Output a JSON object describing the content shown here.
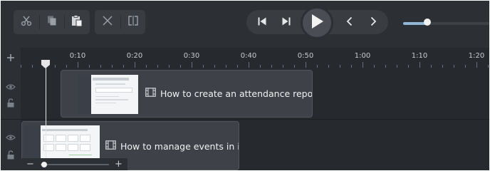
{
  "toolbar": {
    "edit_icons": [
      "scissors-icon",
      "copy-icon",
      "paste-icon"
    ],
    "split_icons": [
      "cut-gap-icon",
      "split-icon"
    ],
    "transport_icons": [
      "skip-to-start-icon",
      "step-forward-icon",
      "play-icon",
      "previous-icon",
      "next-icon"
    ]
  },
  "volume": {
    "level": 0.28
  },
  "ruler": {
    "ticks": [
      "0:10",
      "0:20",
      "0:30",
      "0:40",
      "0:50",
      "1:00",
      "1:10",
      "1:20"
    ]
  },
  "tracks": [
    {
      "clip_title": "How to create an attendance report?"
    },
    {
      "clip_title": "How to manage events in iSp"
    }
  ],
  "zoom": {
    "minus": "−",
    "plus": "+",
    "level": 0.05
  },
  "colors": {
    "background": "#26292d",
    "toolbar": "#2c2f33",
    "clip": "#3e4248",
    "accent": "#8fb6d6"
  }
}
